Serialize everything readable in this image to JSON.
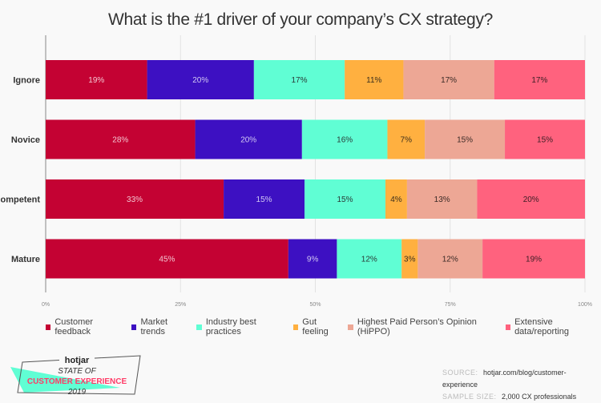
{
  "chart_data": {
    "type": "bar",
    "orientation": "horizontal",
    "stacked": true,
    "title": "What is the #1 driver of your company’s CX strategy?",
    "xlabel": "",
    "ylabel": "",
    "xlim": [
      0,
      100
    ],
    "x_ticks": [
      "0%",
      "25%",
      "50%",
      "75%",
      "100%"
    ],
    "x_tick_values": [
      0,
      25,
      50,
      75,
      100
    ],
    "grid": true,
    "legend_position": "bottom",
    "categories": [
      "Ignore",
      "Novice",
      "Competent",
      "Mature"
    ],
    "series": [
      {
        "name": "Customer feedback",
        "color": "#c40233",
        "label_color": "#f3c6d2",
        "values": [
          19,
          28,
          33,
          45
        ]
      },
      {
        "name": "Market trends",
        "color": "#3d10c2",
        "label_color": "#d2c8f3",
        "values": [
          20,
          20,
          15,
          9
        ]
      },
      {
        "name": "Industry best practices",
        "color": "#60fed4",
        "label_color": "#2a3a36",
        "values": [
          17,
          16,
          15,
          12
        ]
      },
      {
        "name": "Gut feeling",
        "color": "#ffb040",
        "label_color": "#3a2e1c",
        "values": [
          11,
          7,
          4,
          3
        ]
      },
      {
        "name": "Highest Paid Person’s Opinion (HiPPO)",
        "color": "#eda795",
        "label_color": "#3a2a26",
        "values": [
          17,
          15,
          13,
          12
        ]
      },
      {
        "name": "Extensive data/reporting",
        "color": "#ff627e",
        "label_color": "#3a1e24",
        "values": [
          17,
          15,
          20,
          19
        ]
      }
    ],
    "value_suffix": "%"
  },
  "badge": {
    "brand": "hotjar",
    "line1": "STATE OF",
    "line2": "CUSTOMER EXPERIENCE",
    "line3": "2019"
  },
  "source": {
    "source_key": "SOURCE:",
    "source_value": "hotjar.com/blog/customer-experience",
    "sample_key": "SAMPLE SIZE:",
    "sample_value": "2,000 CX professionals"
  }
}
